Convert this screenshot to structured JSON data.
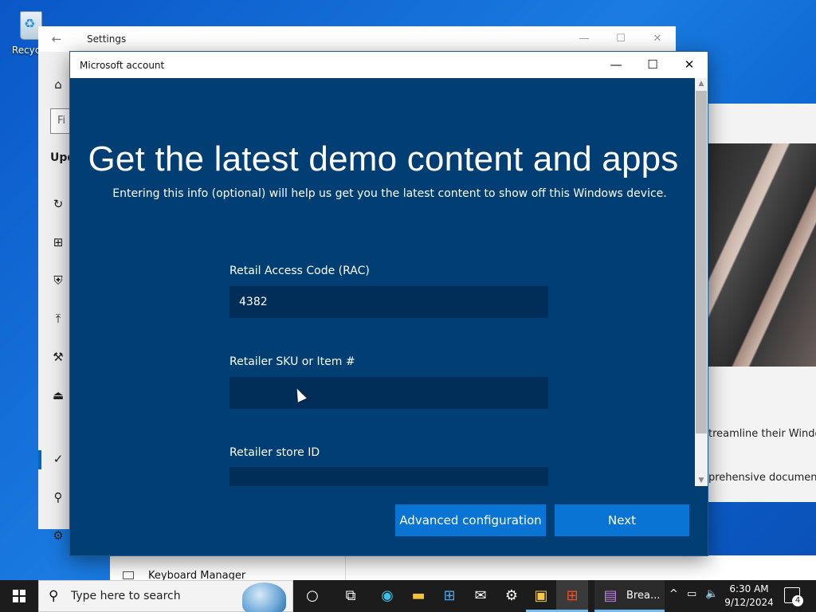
{
  "desktop": {
    "recycle_bin_label": "Recycle"
  },
  "settings_window": {
    "title": "Settings",
    "search_placeholder": "Fi",
    "section_heading": "Upd",
    "controls": {
      "minimize": "—",
      "maximize": "☐",
      "close": "✕"
    },
    "nav_icons": [
      "home-icon",
      "refresh-icon",
      "delivery-icon",
      "shield-icon",
      "backup-icon",
      "wrench-icon",
      "recovery-icon",
      "activation-icon",
      "find-device-icon",
      "developer-icon"
    ]
  },
  "background_content": {
    "text_line_1": "treamline their Windo",
    "text_line_2": "prehensive document",
    "keyboard_manager_label": "Keyboard Manager"
  },
  "dialog": {
    "title": "Microsoft account",
    "controls": {
      "minimize": "—",
      "maximize": "☐",
      "close": "✕"
    },
    "heading": "Get the latest demo content and apps",
    "subheading": "Entering this info (optional) will help us get you the latest content to show off this Windows device.",
    "fields": [
      {
        "label": "Retail Access Code (RAC)",
        "value": "4382"
      },
      {
        "label": "Retailer SKU or Item #",
        "value": ""
      },
      {
        "label": "Retailer store ID",
        "value": ""
      }
    ],
    "buttons": {
      "advanced": "Advanced configuration",
      "next": "Next"
    },
    "colors": {
      "background": "#003e73",
      "input_background": "#002e58",
      "button": "#0a74d4"
    }
  },
  "taskbar": {
    "search_placeholder": "Type here to search",
    "pinned_icons": [
      "cortana-icon",
      "task-view-icon",
      "edge-icon",
      "file-explorer-icon",
      "store-icon",
      "mail-icon",
      "settings-icon",
      "app-icon",
      "microsoft-icon",
      "breakfast-app-icon"
    ],
    "app_label": "Brea...",
    "tray": {
      "chevron": "^",
      "clock_time": "6:30 AM",
      "clock_date": "9/12/2024",
      "notification_count": "4"
    }
  }
}
